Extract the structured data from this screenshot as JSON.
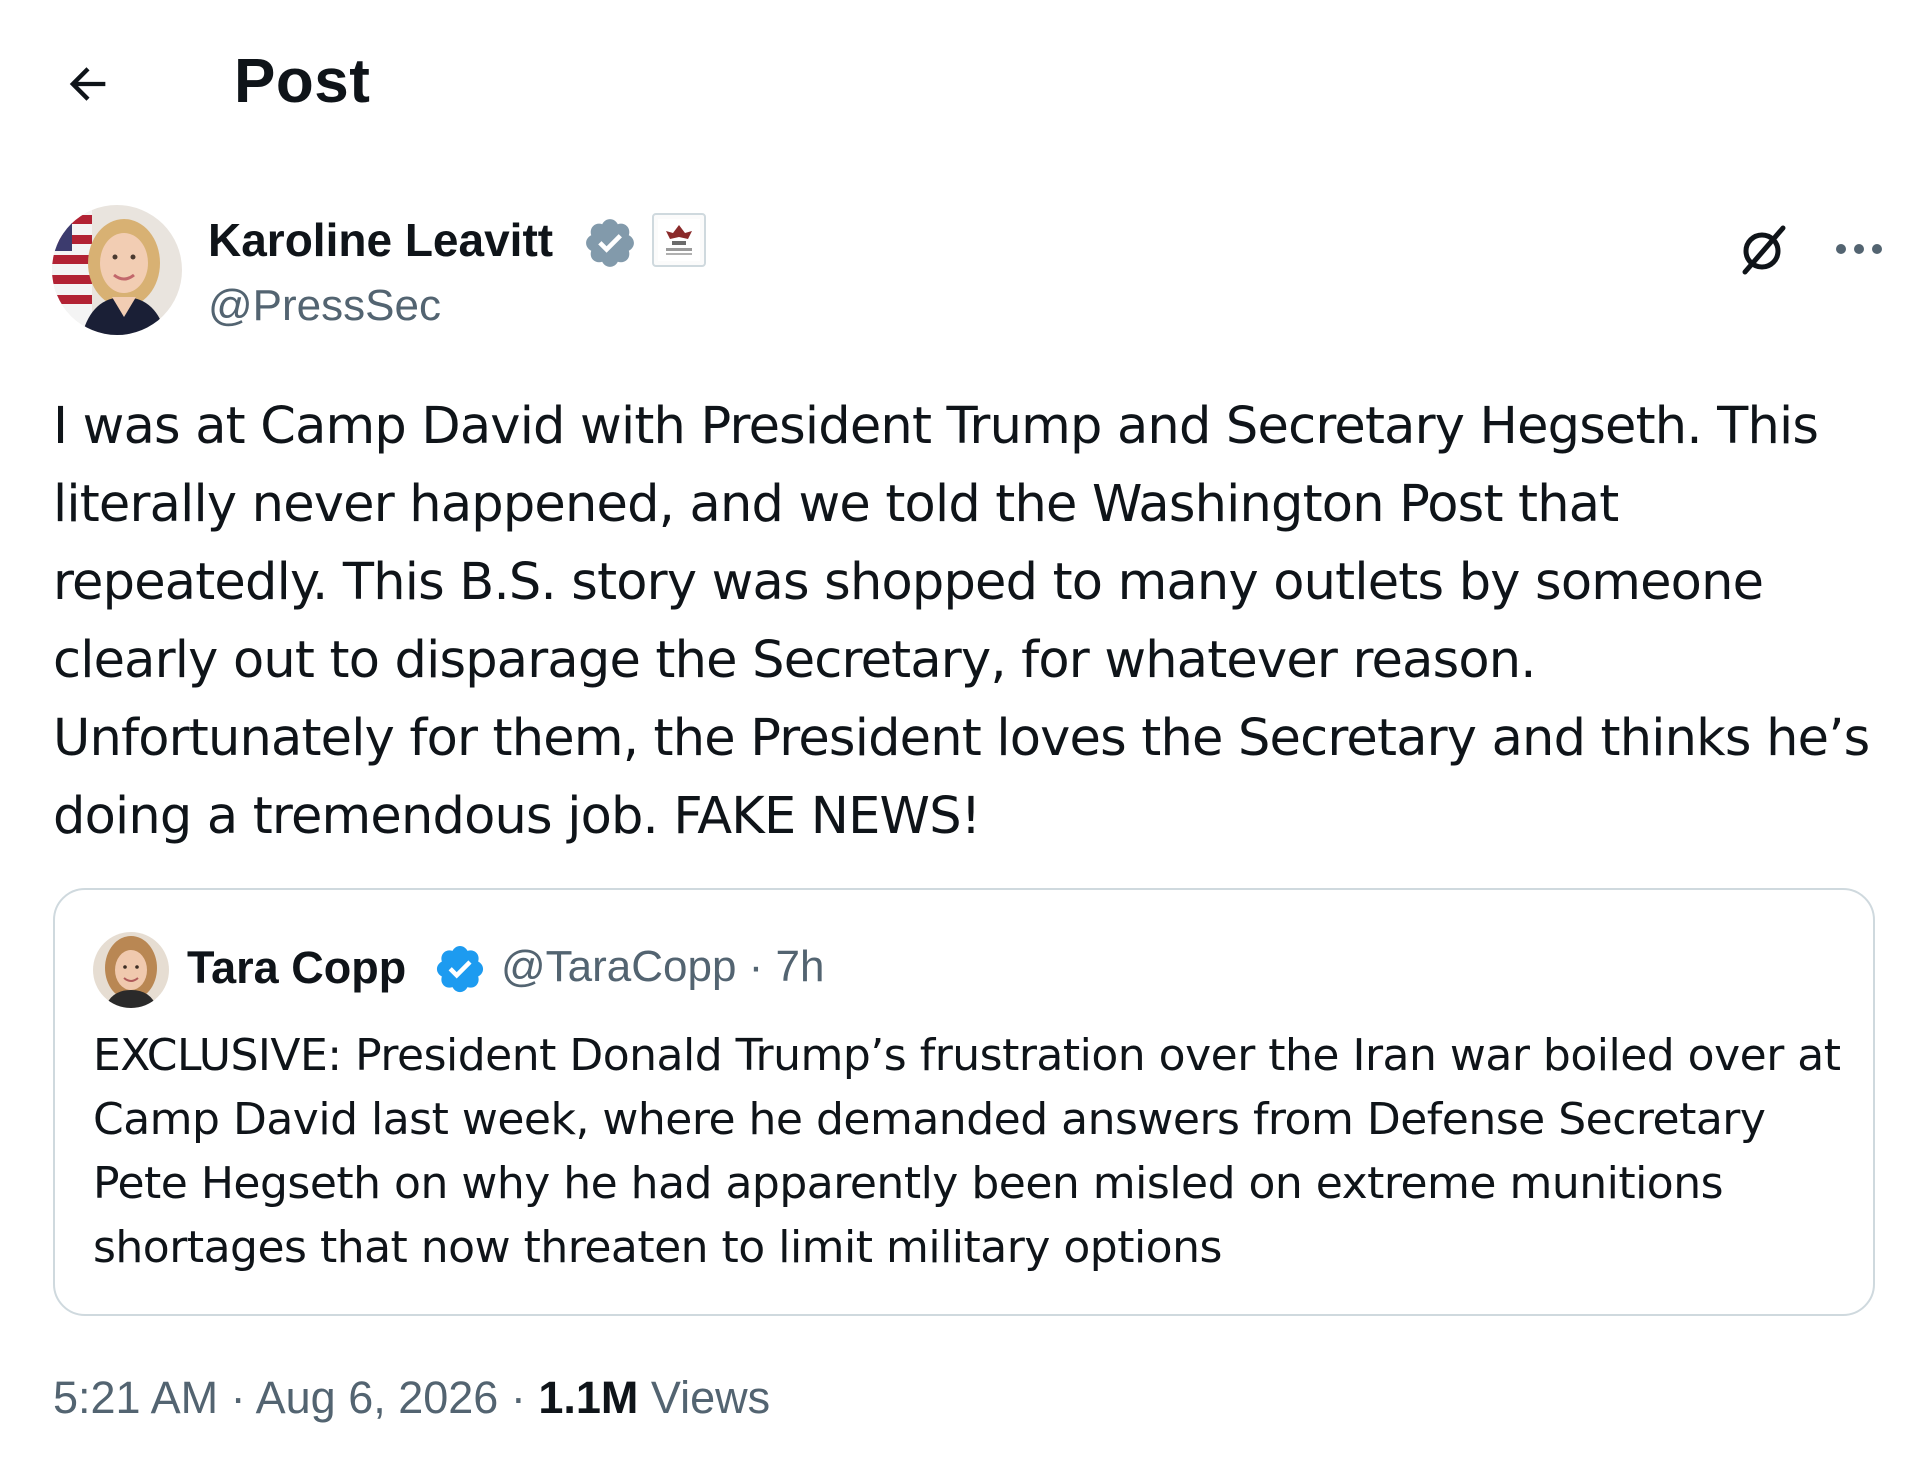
{
  "header": {
    "title": "Post"
  },
  "post": {
    "author_name": "Karoline Leavitt",
    "author_handle": "@PressSec",
    "text": "I was at Camp David with President Trump and Secretary Hegseth. This literally never happened, and we told the Washington Post that repeatedly. This B.S. story was shopped to many outlets by someone clearly out to disparage the Secretary, for whatever reason. Unfortunately for them, the President loves the Secretary and thinks he’s doing a tremendous job. FAKE NEWS!",
    "time": "5:21 AM",
    "separator": " · ",
    "date": "Aug 6, 2026",
    "views_count": "1.1M",
    "views_label": " Views"
  },
  "quoted_post": {
    "author_name": "Tara Copp",
    "meta": "@TaraCopp · 7h",
    "text": "EXCLUSIVE: President Donald Trump’s frustration over the Iran war boiled over at Camp David last week, where he demanded answers from Defense Secretary Pete Hegseth on why he had apparently been misled on extreme munitions shortages that now threaten to limit military options"
  },
  "icons": {
    "back": "arrow-left-icon",
    "verified": "verified-badge-icon",
    "affiliate": "government-seal-icon",
    "grok": "grok-icon",
    "more": "more-dots-icon"
  },
  "colors": {
    "text_primary": "#0f1419",
    "text_secondary": "#536471",
    "verified_gray": "#829aab",
    "verified_blue": "#1d9bf0",
    "border": "#cfd9de"
  }
}
